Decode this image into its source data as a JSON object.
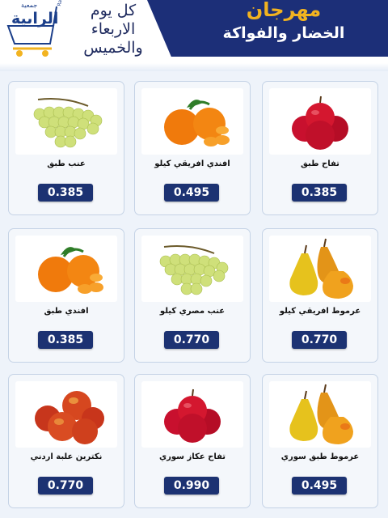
{
  "header": {
    "logo_top": "جمعية",
    "logo_name": "الرابية",
    "logo_sub": "Rabiya Co-op",
    "days_line1": "كل يوم",
    "days_line2": "الاربعاء",
    "days_line3": "والخميس",
    "title": "مهرجان",
    "subtitle": "الخضار والفواكة"
  },
  "colors": {
    "navy": "#1c2f78",
    "gold": "#f2b320",
    "price_bg": "#1c3272"
  },
  "products": [
    {
      "name": "تفاح طبق",
      "price": "0.385",
      "image": "red-apples"
    },
    {
      "name": "افندي افريقي كيلو",
      "price": "0.495",
      "image": "tangerines"
    },
    {
      "name": "عنب طبق",
      "price": "0.385",
      "image": "green-grapes"
    },
    {
      "name": "عرموط افريقي كيلو",
      "price": "0.770",
      "image": "pears"
    },
    {
      "name": "عنب مصري كيلو",
      "price": "0.770",
      "image": "green-grapes"
    },
    {
      "name": "افندي طبق",
      "price": "0.385",
      "image": "tangerines"
    },
    {
      "name": "عرموط طبق سوري",
      "price": "0.495",
      "image": "pears"
    },
    {
      "name": "تفاح عكاز سوري",
      "price": "0.990",
      "image": "red-apples"
    },
    {
      "name": "نكترين علبة اردني",
      "price": "0.770",
      "image": "nectarines"
    }
  ]
}
